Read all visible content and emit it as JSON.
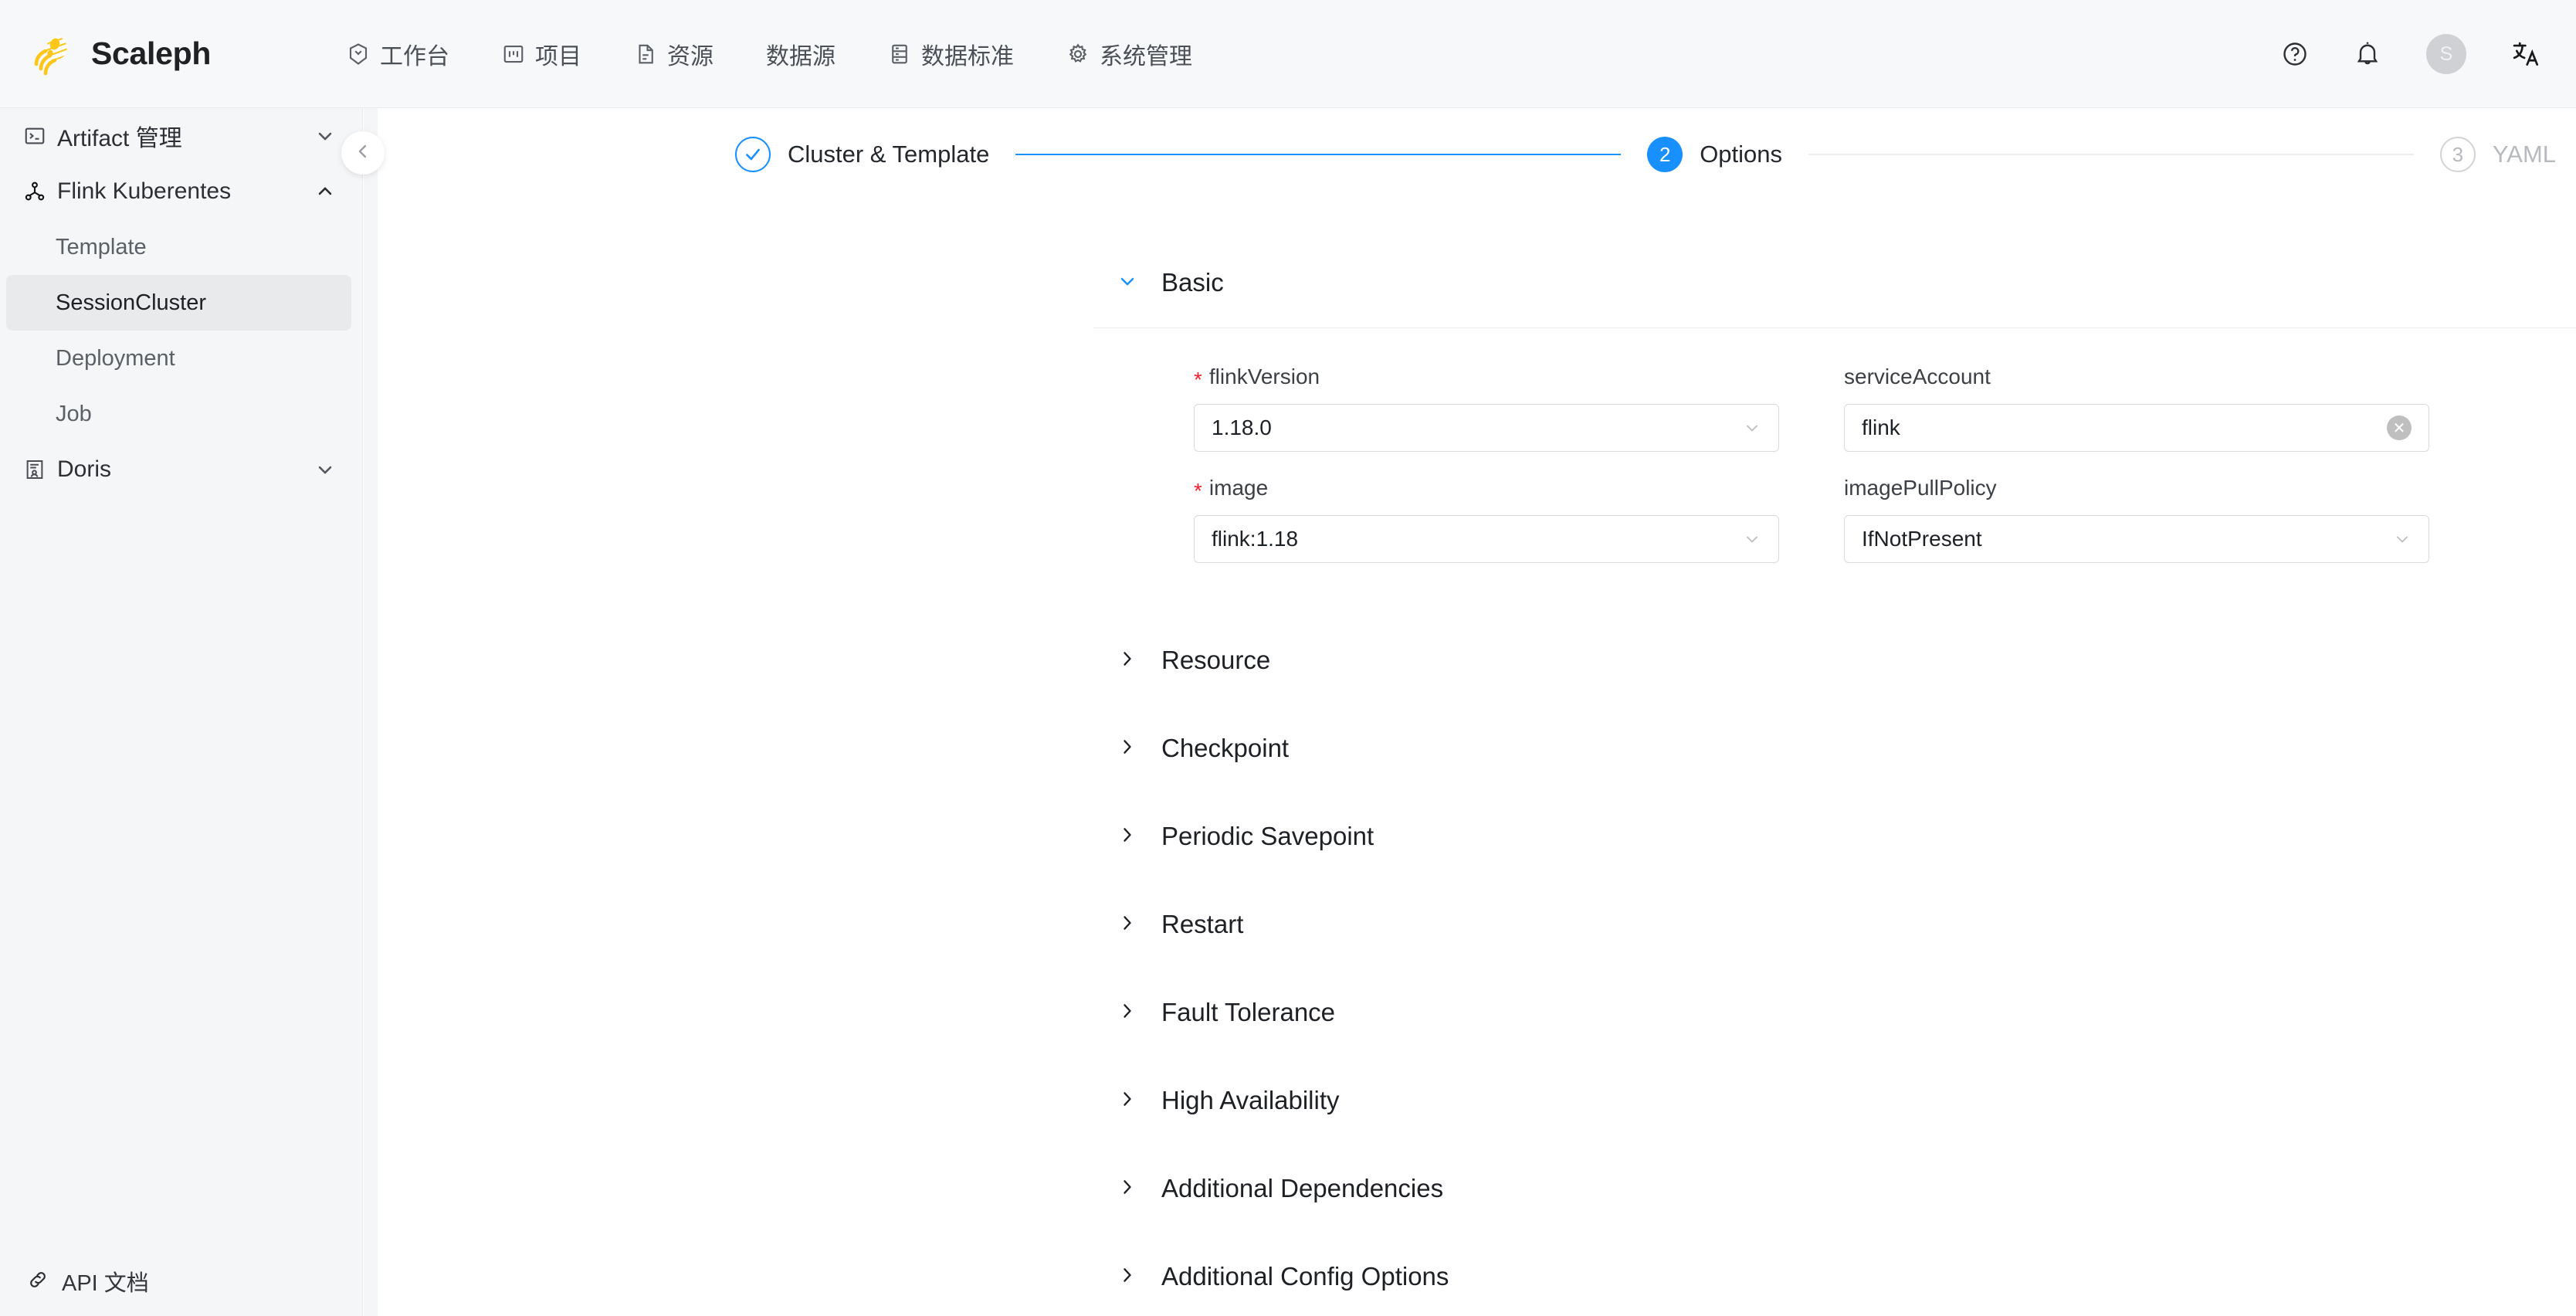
{
  "header": {
    "brand": "Scaleph",
    "logo_icon": "jellyfish-logo",
    "brand_color": "#ffc61a",
    "nav": [
      {
        "label": "工作台",
        "icon": "workbench-icon"
      },
      {
        "label": "项目",
        "icon": "project-icon"
      },
      {
        "label": "资源",
        "icon": "resource-file-icon"
      },
      {
        "label": "数据源",
        "icon": ""
      },
      {
        "label": "数据标准",
        "icon": "data-standard-icon"
      },
      {
        "label": "系统管理",
        "icon": "gear-icon"
      }
    ],
    "actions": {
      "help": "help-circle-icon",
      "notifications": "bell-icon",
      "avatar_initial": "S",
      "language": "translate-icon"
    }
  },
  "sidebar": {
    "groups": [
      {
        "label": "Artifact 管理",
        "icon": "console-icon",
        "expanded": false
      },
      {
        "label": "Flink Kuberentes",
        "icon": "cluster-icon",
        "expanded": true
      },
      {
        "label": "Doris",
        "icon": "solution-user-icon",
        "expanded": false
      }
    ],
    "flink_items": [
      {
        "label": "Template",
        "selected": false
      },
      {
        "label": "SessionCluster",
        "selected": true
      },
      {
        "label": "Deployment",
        "selected": false
      },
      {
        "label": "Job",
        "selected": false
      }
    ],
    "footer": {
      "label": "API 文档",
      "icon": "link-icon"
    },
    "collapse_icon": "chevron-left-icon"
  },
  "stepper": {
    "steps": [
      {
        "index": "1",
        "label": "Cluster & Template",
        "state": "done"
      },
      {
        "index": "2",
        "label": "Options",
        "state": "active"
      },
      {
        "index": "3",
        "label": "YAML",
        "state": "wait"
      }
    ],
    "active_color": "#1890ff",
    "inactive_color": "#b6b9bd"
  },
  "form": {
    "basic": {
      "title": "Basic",
      "expanded": true,
      "chevron_icon": "chevron-down-icon",
      "fields": [
        {
          "label": "flinkVersion",
          "required": true,
          "type": "select",
          "value": "1.18.0",
          "suffix_icon": "chevron-down-icon"
        },
        {
          "label": "serviceAccount",
          "required": false,
          "type": "input",
          "value": "flink",
          "suffix_icon": "clear-circle-icon",
          "clear_glyph": "✕"
        },
        {
          "label": "image",
          "required": true,
          "type": "select",
          "value": "flink:1.18",
          "suffix_icon": "chevron-down-icon"
        },
        {
          "label": "imagePullPolicy",
          "required": false,
          "type": "select",
          "value": "IfNotPresent",
          "suffix_icon": "chevron-down-icon"
        }
      ]
    },
    "collapsed_sections": [
      {
        "title": "Resource",
        "chevron_icon": "chevron-right-icon"
      },
      {
        "title": "Checkpoint",
        "chevron_icon": "chevron-right-icon"
      },
      {
        "title": "Periodic Savepoint",
        "chevron_icon": "chevron-right-icon"
      },
      {
        "title": "Restart",
        "chevron_icon": "chevron-right-icon"
      },
      {
        "title": "Fault Tolerance",
        "chevron_icon": "chevron-right-icon"
      },
      {
        "title": "High Availability",
        "chevron_icon": "chevron-right-icon"
      },
      {
        "title": "Additional Dependencies",
        "chevron_icon": "chevron-right-icon"
      },
      {
        "title": "Additional Config Options",
        "chevron_icon": "chevron-right-icon"
      }
    ]
  }
}
